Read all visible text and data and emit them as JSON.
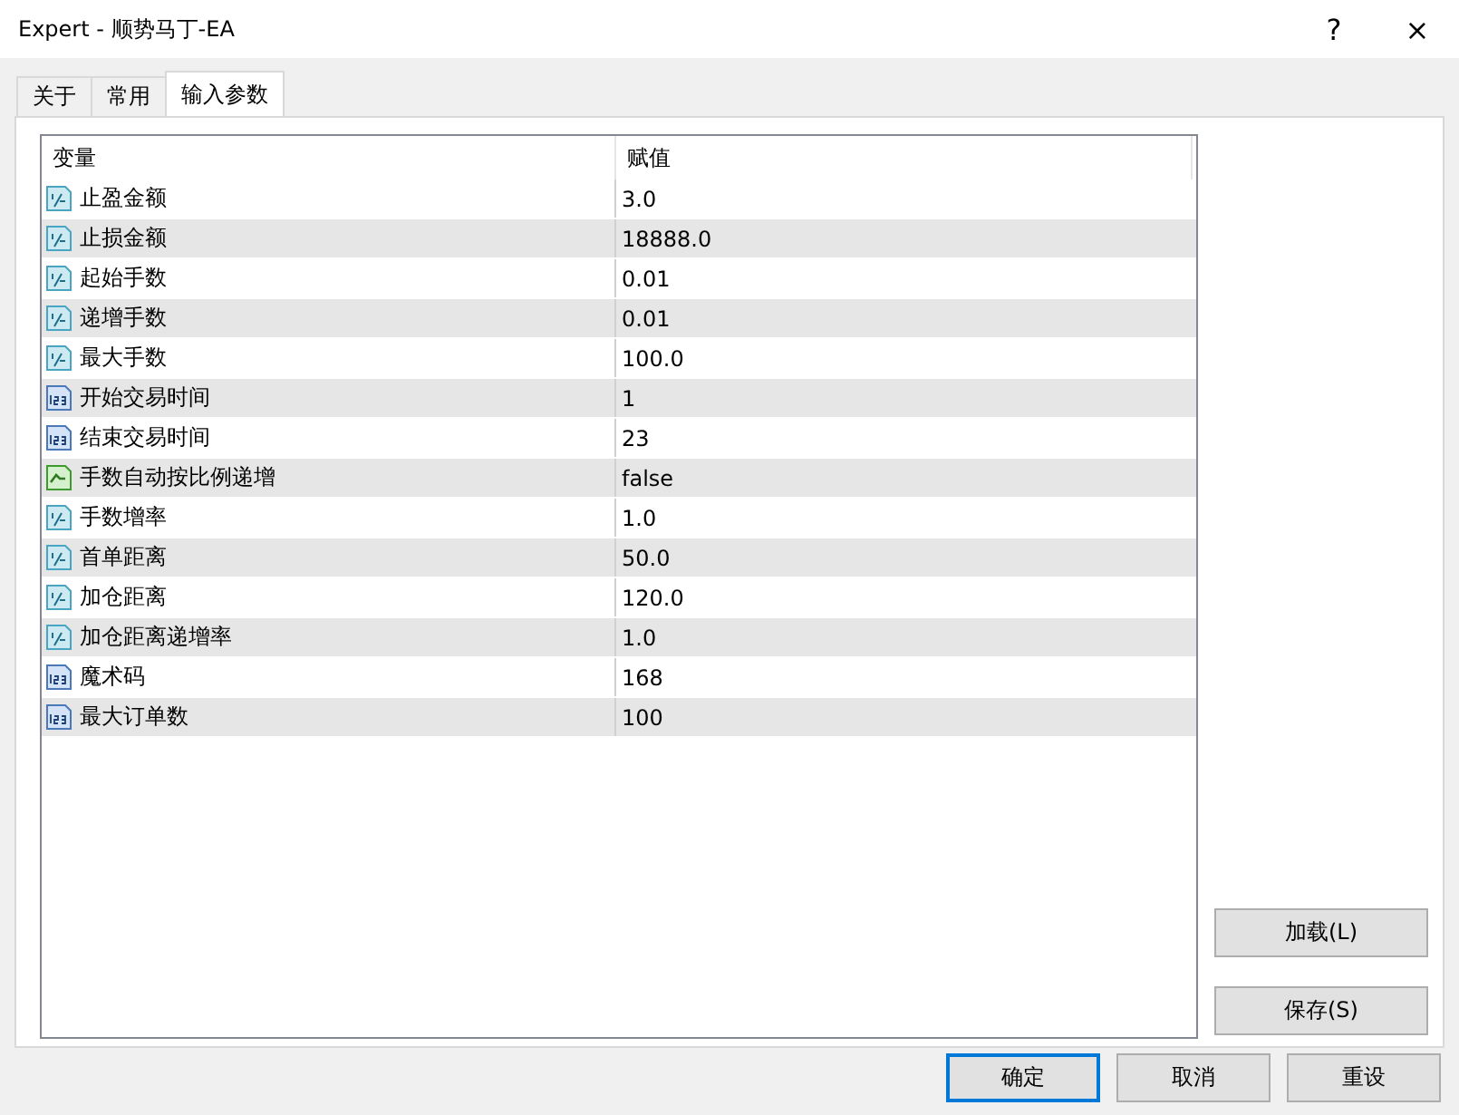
{
  "window": {
    "title": "Expert - 顺势马丁-EA",
    "help_button": "?",
    "close_button": "×"
  },
  "tabs": [
    {
      "label": "关于",
      "selected": false
    },
    {
      "label": "常用",
      "selected": false
    },
    {
      "label": "输入参数",
      "selected": true
    }
  ],
  "table": {
    "columns": [
      "变量",
      "赋值"
    ],
    "rows": [
      {
        "kind": "double",
        "name": "止盈金额",
        "value": "3.0"
      },
      {
        "kind": "double",
        "name": "止损金额",
        "value": "18888.0"
      },
      {
        "kind": "double",
        "name": "起始手数",
        "value": "0.01"
      },
      {
        "kind": "double",
        "name": "递增手数",
        "value": "0.01"
      },
      {
        "kind": "double",
        "name": "最大手数",
        "value": "100.0"
      },
      {
        "kind": "int",
        "name": "开始交易时间",
        "value": "1"
      },
      {
        "kind": "int",
        "name": "结束交易时间",
        "value": "23"
      },
      {
        "kind": "bool",
        "name": "手数自动按比例递增",
        "value": "false"
      },
      {
        "kind": "double",
        "name": "手数增率",
        "value": "1.0"
      },
      {
        "kind": "double",
        "name": "首单距离",
        "value": "50.0"
      },
      {
        "kind": "double",
        "name": "加仓距离",
        "value": "120.0"
      },
      {
        "kind": "double",
        "name": "加仓距离递增率",
        "value": "1.0"
      },
      {
        "kind": "int",
        "name": "魔术码",
        "value": "168"
      },
      {
        "kind": "int",
        "name": "最大订单数",
        "value": "100"
      }
    ]
  },
  "side_buttons": [
    "加载(L)",
    "保存(S)"
  ],
  "footer_buttons": [
    {
      "label": "确定",
      "selected": true
    },
    {
      "label": "取消",
      "selected": false
    },
    {
      "label": "重设",
      "selected": false
    }
  ]
}
